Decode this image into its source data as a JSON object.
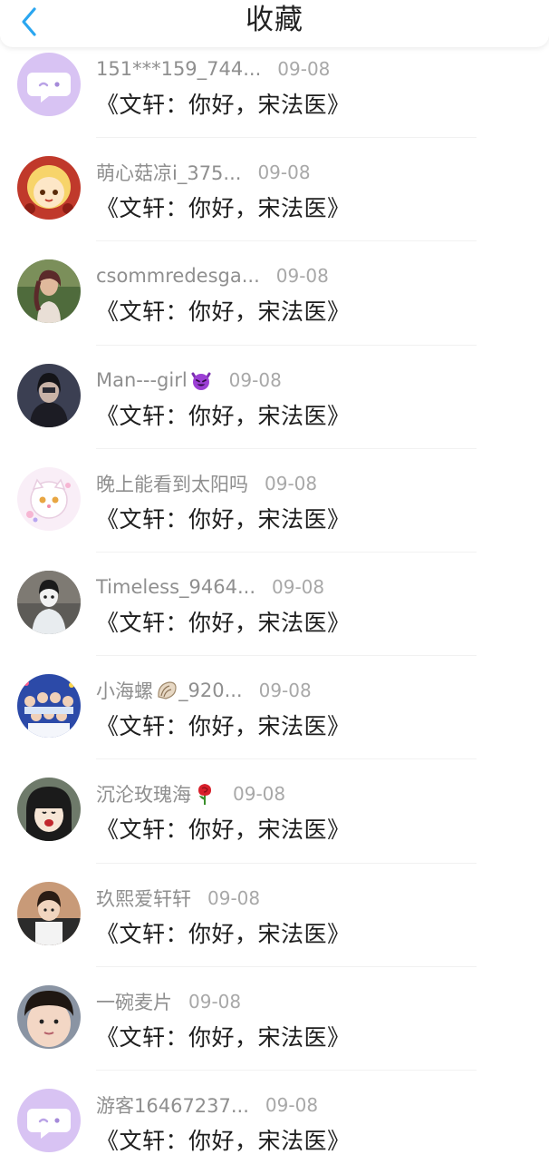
{
  "header": {
    "title": "收藏",
    "back_icon": "chevron-left-icon",
    "accent": "#2aa6f0"
  },
  "items": [
    {
      "user": "151***159_744...",
      "date": "09-08",
      "book": "《文轩：你好，宋法医》",
      "avatar": "default-chat-avatar"
    },
    {
      "user": "萌心菇凉i_375...",
      "date": "09-08",
      "book": "《文轩：你好，宋法医》",
      "avatar": "cartoon-girl-avatar"
    },
    {
      "user": "csommredesga...",
      "date": "09-08",
      "book": "《文轩：你好，宋法医》",
      "avatar": "photo-woman-avatar"
    },
    {
      "user": "Man---girl",
      "emoji": "devil-emoji",
      "date": "09-08",
      "book": "《文轩：你好，宋法医》",
      "avatar": "dark-photo-avatar"
    },
    {
      "user": "晚上能看到太阳吗",
      "date": "09-08",
      "book": "《文轩：你好，宋法医》",
      "avatar": "cute-cat-avatar"
    },
    {
      "user": "Timeless_9464...",
      "date": "09-08",
      "book": "《文轩：你好，宋法医》",
      "avatar": "masked-person-avatar"
    },
    {
      "user": "小海螺",
      "emoji": "shell-emoji",
      "user_suffix": "_920...",
      "date": "09-08",
      "book": "《文轩：你好，宋法医》",
      "avatar": "group-photo-avatar"
    },
    {
      "user": "沉沦玫瑰海",
      "emoji": "rose-emoji",
      "date": "09-08",
      "book": "《文轩：你好，宋法医》",
      "avatar": "anime-girl-avatar"
    },
    {
      "user": "玖熙爱轩轩",
      "date": "09-08",
      "book": "《文轩：你好，宋法医》",
      "avatar": "boy-photo-avatar"
    },
    {
      "user": "一碗麦片",
      "date": "09-08",
      "book": "《文轩：你好，宋法医》",
      "avatar": "child-photo-avatar"
    },
    {
      "user": "游客16467237...",
      "date": "09-08",
      "book": "《文轩：你好，宋法医》",
      "avatar": "default-chat-avatar"
    }
  ]
}
